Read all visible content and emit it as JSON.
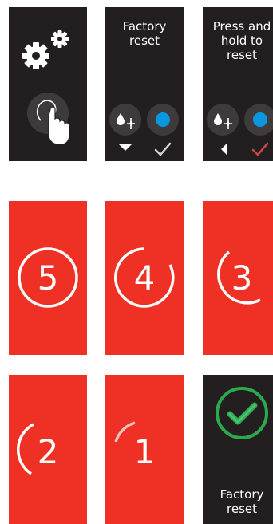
{
  "panels": {
    "factory_reset_title": "Factory\nreset",
    "press_hold_title": "Press and\nhold to\nreset",
    "final_title": "Factory\nreset"
  },
  "countdown": [
    "5",
    "4",
    "3",
    "2",
    "1"
  ],
  "colors": {
    "dark_bg": "#231f20",
    "red_bg": "#ee3124",
    "blue_dot": "#0a96e1",
    "success_green": "#2ca94e",
    "check_white": "#cfcfcf",
    "check_red": "#c9474b"
  },
  "icons": [
    "gear-icon",
    "touch-hand-icon",
    "drop-sparkle-icon",
    "chevron-down-icon",
    "chevron-left-icon",
    "checkmark-icon",
    "success-check-icon"
  ]
}
